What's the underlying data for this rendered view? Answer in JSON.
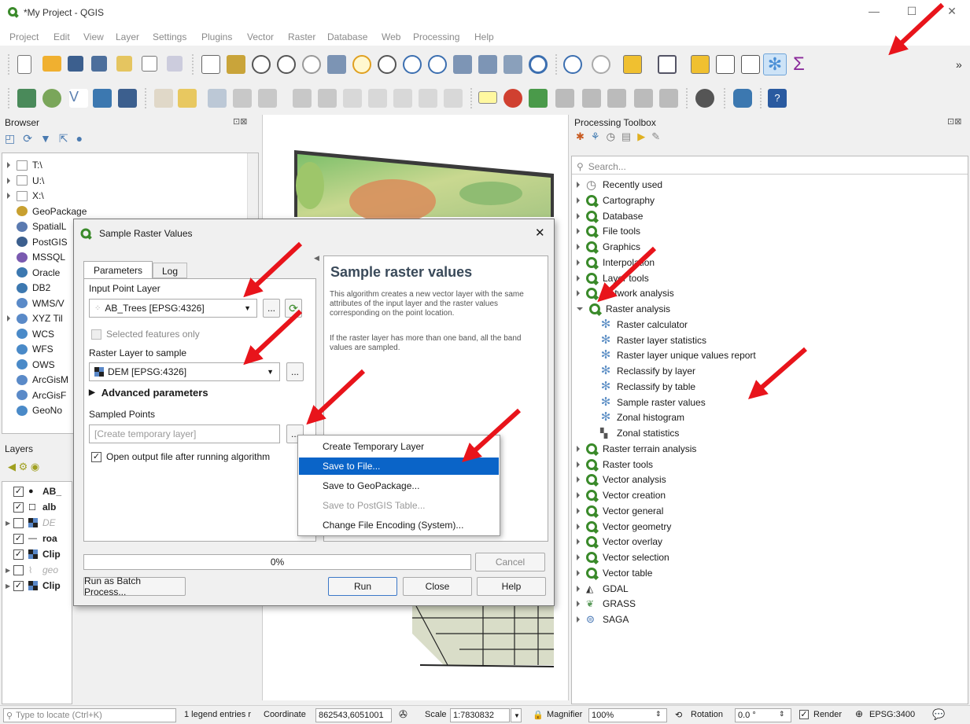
{
  "window": {
    "title": "*My Project - QGIS"
  },
  "menu": [
    "Project",
    "Edit",
    "View",
    "Layer",
    "Settings",
    "Plugins",
    "Vector",
    "Raster",
    "Database",
    "Web",
    "Processing",
    "Help"
  ],
  "toolbar_overflow": "»",
  "browser": {
    "title": "Browser",
    "items": [
      {
        "label": "T:\\",
        "icon": "folder-icon"
      },
      {
        "label": "U:\\",
        "icon": "folder-icon"
      },
      {
        "label": "X:\\",
        "icon": "folder-icon"
      },
      {
        "label": "GeoPackage",
        "icon": "geopackage-icon"
      },
      {
        "label": "SpatialL",
        "icon": "spatialite-icon"
      },
      {
        "label": "PostGIS",
        "icon": "postgis-icon"
      },
      {
        "label": "MSSQL",
        "icon": "mssql-icon"
      },
      {
        "label": "Oracle",
        "icon": "oracle-icon"
      },
      {
        "label": "DB2",
        "icon": "db2-icon"
      },
      {
        "label": "WMS/V",
        "icon": "wms-icon"
      },
      {
        "label": "XYZ Til",
        "icon": "xyz-icon"
      },
      {
        "label": "WCS",
        "icon": "wcs-icon"
      },
      {
        "label": "WFS",
        "icon": "wfs-icon"
      },
      {
        "label": "OWS",
        "icon": "ows-icon"
      },
      {
        "label": "ArcGisM",
        "icon": "arcgis-icon"
      },
      {
        "label": "ArcGisF",
        "icon": "arcgis-icon"
      },
      {
        "label": "GeoNo",
        "icon": "geonode-icon"
      }
    ]
  },
  "layers": {
    "title": "Layers",
    "items": [
      {
        "label": "AB_",
        "checked": true
      },
      {
        "label": "alb",
        "checked": true
      },
      {
        "label": "DE",
        "checked": false
      },
      {
        "label": "roa",
        "checked": true
      },
      {
        "label": "Clip",
        "checked": true
      },
      {
        "label": "geo",
        "checked": false
      },
      {
        "label": "Clip",
        "checked": true
      }
    ]
  },
  "dialog": {
    "title": "Sample Raster Values",
    "tabs": [
      "Parameters",
      "Log"
    ],
    "input_point_label": "Input Point Layer",
    "input_point_value": "AB_Trees [EPSG:4326]",
    "selected_only_label": "Selected features only",
    "raster_label": "Raster Layer to sample",
    "raster_value": "DEM [EPSG:4326]",
    "advanced_label": "Advanced parameters",
    "sampled_label": "Sampled Points",
    "sampled_placeholder": "[Create temporary layer]",
    "open_output_label": "Open output file after running algorithm",
    "browse_btn": "...",
    "help_title": "Sample raster values",
    "help_p1": "This algorithm creates a new vector layer with the same attributes of the input layer and the raster values corresponding on the point location.",
    "help_p2": "If the raster layer has more than one band, all the band values are sampled.",
    "progress_text": "0%",
    "progress_value": 0,
    "cancel": "Cancel",
    "batch": "Run as Batch Process...",
    "run": "Run",
    "close": "Close",
    "help": "Help"
  },
  "popup": {
    "items": [
      {
        "label": "Create Temporary Layer",
        "state": "normal"
      },
      {
        "label": "Save to File...",
        "state": "selected"
      },
      {
        "label": "Save to GeoPackage...",
        "state": "normal"
      },
      {
        "label": "Save to PostGIS Table...",
        "state": "disabled"
      },
      {
        "label": "Change File Encoding (System)...",
        "state": "normal"
      }
    ]
  },
  "toolbox": {
    "title": "Processing Toolbox",
    "search_placeholder": "Search...",
    "items": [
      {
        "label": "Recently used",
        "kind": "clock",
        "expanded": false,
        "indent": 0
      },
      {
        "label": "Cartography",
        "kind": "q",
        "expanded": false,
        "indent": 0
      },
      {
        "label": "Database",
        "kind": "q",
        "expanded": false,
        "indent": 0
      },
      {
        "label": "File tools",
        "kind": "q",
        "expanded": false,
        "indent": 0
      },
      {
        "label": "Graphics",
        "kind": "q",
        "expanded": false,
        "indent": 0
      },
      {
        "label": "Interpolation",
        "kind": "q",
        "expanded": false,
        "indent": 0
      },
      {
        "label": "Layer tools",
        "kind": "q",
        "expanded": false,
        "indent": 0
      },
      {
        "label": "Network analysis",
        "kind": "q",
        "expanded": false,
        "indent": 0
      },
      {
        "label": "Raster analysis",
        "kind": "q",
        "expanded": true,
        "indent": 0
      },
      {
        "label": "Raster calculator",
        "kind": "gear",
        "indent": 1
      },
      {
        "label": "Raster layer statistics",
        "kind": "gear",
        "indent": 1
      },
      {
        "label": "Raster layer unique values report",
        "kind": "gear",
        "indent": 1
      },
      {
        "label": "Reclassify by layer",
        "kind": "gear",
        "indent": 1
      },
      {
        "label": "Reclassify by table",
        "kind": "gear",
        "indent": 1
      },
      {
        "label": "Sample raster values",
        "kind": "gear",
        "indent": 1
      },
      {
        "label": "Zonal histogram",
        "kind": "gear",
        "indent": 1
      },
      {
        "label": "Zonal statistics",
        "kind": "zonal",
        "indent": 1
      },
      {
        "label": "Raster terrain analysis",
        "kind": "q",
        "expanded": false,
        "indent": 0
      },
      {
        "label": "Raster tools",
        "kind": "q",
        "expanded": false,
        "indent": 0
      },
      {
        "label": "Vector analysis",
        "kind": "q",
        "expanded": false,
        "indent": 0
      },
      {
        "label": "Vector creation",
        "kind": "q",
        "expanded": false,
        "indent": 0
      },
      {
        "label": "Vector general",
        "kind": "q",
        "expanded": false,
        "indent": 0
      },
      {
        "label": "Vector geometry",
        "kind": "q",
        "expanded": false,
        "indent": 0
      },
      {
        "label": "Vector overlay",
        "kind": "q",
        "expanded": false,
        "indent": 0
      },
      {
        "label": "Vector selection",
        "kind": "q",
        "expanded": false,
        "indent": 0
      },
      {
        "label": "Vector table",
        "kind": "q",
        "expanded": false,
        "indent": 0
      },
      {
        "label": "GDAL",
        "kind": "gdal",
        "expanded": false,
        "indent": 0
      },
      {
        "label": "GRASS",
        "kind": "grass",
        "expanded": false,
        "indent": 0
      },
      {
        "label": "SAGA",
        "kind": "saga",
        "expanded": false,
        "indent": 0
      }
    ]
  },
  "status": {
    "locate_placeholder": "Type to locate (Ctrl+K)",
    "legend_text": "1 legend entries r",
    "coordinate_label": "Coordinate",
    "coordinate_value": "862543,6051001",
    "scale_label": "Scale",
    "scale_value": "1:7830832",
    "magnifier_label": "Magnifier",
    "magnifier_value": "100%",
    "rotation_label": "Rotation",
    "rotation_value": "0.0 °",
    "render_label": "Render",
    "crs": "EPSG:3400"
  },
  "colors": {
    "accent_red": "#e8141b",
    "selection_blue": "#0a64c8",
    "qgis_green": "#3a8a2a"
  }
}
